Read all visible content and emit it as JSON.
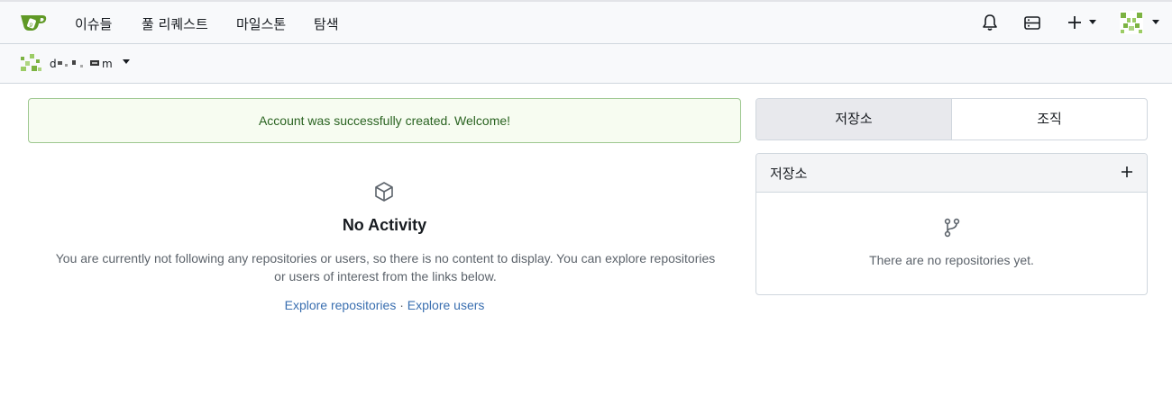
{
  "header": {
    "nav": [
      "이슈들",
      "풀 리퀘스트",
      "마일스톤",
      "탐색"
    ],
    "icons": [
      "gitea-logo-icon",
      "bell-icon",
      "server-icon",
      "plus-icon",
      "avatar"
    ]
  },
  "context": {
    "user_name": "d…m (obscured)",
    "icons": [
      "avatar",
      "caret-down-icon"
    ]
  },
  "flash": {
    "message": "Account was successfully created. Welcome!"
  },
  "feed": {
    "empty_title": "No Activity",
    "empty_desc": "You are currently not following any repositories or users, so there is no content to display. You can explore repositories or users of interest from the links below.",
    "link_repos": "Explore repositories",
    "separator": "·",
    "link_users": "Explore users"
  },
  "sidebar": {
    "tabs": [
      "저장소",
      "조직"
    ],
    "active_tab": "저장소",
    "repo_box_title": "저장소",
    "repo_empty": "There are no repositories yet."
  },
  "colors": {
    "logo_green": "#609926",
    "link": "#3a6fb0",
    "flash_bg": "#f7fcf1",
    "flash_border": "#9dc78f",
    "flash_text": "#2a6321"
  }
}
